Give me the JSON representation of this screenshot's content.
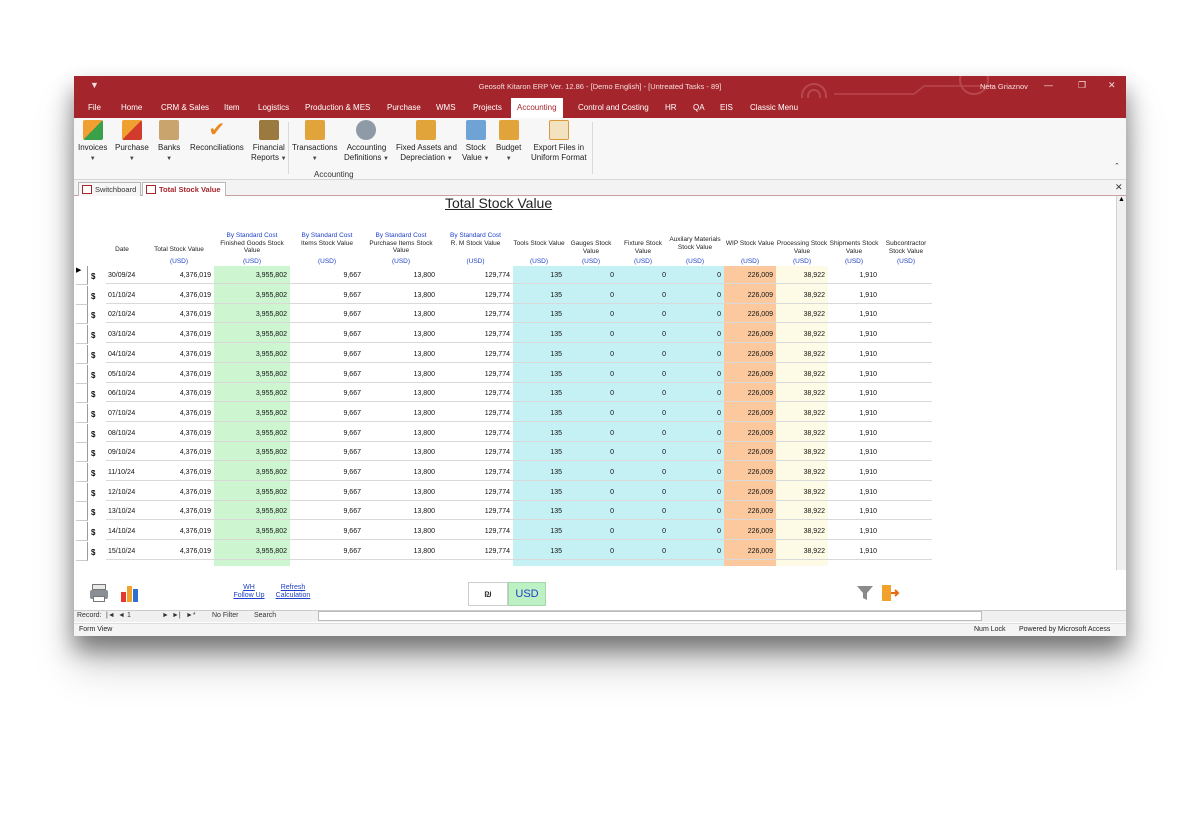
{
  "window": {
    "title": "Geosoft Kitaron ERP Ver. 12.86 - [Demo English] - [Untreated Tasks - 89]",
    "user": "Neta Griaznov"
  },
  "menu": [
    "File",
    "Home",
    "CRM & Sales",
    "Item",
    "Logistics",
    "Production & MES",
    "Purchase",
    "WMS",
    "Projects",
    "Accounting",
    "Control and Costing",
    "HR",
    "QA",
    "EIS",
    "Classic Menu"
  ],
  "menu_active": "Accounting",
  "ribbon": {
    "invoices": "Invoices",
    "purchase": "Purchase",
    "banks": "Banks",
    "reconciliations": "Reconciliations",
    "financial_1": "Financial",
    "financial_2": "Reports",
    "transactions": "Transactions",
    "accdef_1": "Accounting",
    "accdef_2": "Definitions",
    "fixed_1": "Fixed Assets and",
    "fixed_2": "Depreciation",
    "stock_1": "Stock",
    "stock_2": "Value",
    "budget": "Budget",
    "export_1": "Export Files in",
    "export_2": "Uniform Format",
    "group_label": "Accounting"
  },
  "tabs": {
    "switchboard": "Switchboard",
    "total_stock": "Total Stock Value"
  },
  "form_title": "Total Stock Value",
  "headers": {
    "date": "Date",
    "total": "Total Stock Value",
    "std": "By Standard Cost",
    "fg": "Finished Goods Stock Value",
    "items": "Items Stock Value",
    "purch": "Purchase Items Stock Value",
    "rm": "R. M Stock Value",
    "tools": "Tools Stock Value",
    "gauges": "Gauges Stock Value",
    "fixture": "Fixture Stock Value",
    "aux": "Auxilary Materials Stock Value",
    "wip": "WIP Stock Value",
    "processing": "Processing Stock Value",
    "shipments": "Shipments Stock Value",
    "subcon": "Subcontractor Stock Value",
    "usd": "(USD)"
  },
  "rows": [
    {
      "date": "30/09/24",
      "total": "4,376,019",
      "fg": "3,955,802",
      "items": "9,667",
      "purch": "13,800",
      "rm": "129,774",
      "tools": "135",
      "gauges": "0",
      "fixture": "0",
      "aux": "0",
      "wip": "226,009",
      "processing": "38,922",
      "shipments": "1,910",
      "subcon": ""
    },
    {
      "date": "01/10/24",
      "total": "4,376,019",
      "fg": "3,955,802",
      "items": "9,667",
      "purch": "13,800",
      "rm": "129,774",
      "tools": "135",
      "gauges": "0",
      "fixture": "0",
      "aux": "0",
      "wip": "226,009",
      "processing": "38,922",
      "shipments": "1,910",
      "subcon": ""
    },
    {
      "date": "02/10/24",
      "total": "4,376,019",
      "fg": "3,955,802",
      "items": "9,667",
      "purch": "13,800",
      "rm": "129,774",
      "tools": "135",
      "gauges": "0",
      "fixture": "0",
      "aux": "0",
      "wip": "226,009",
      "processing": "38,922",
      "shipments": "1,910",
      "subcon": ""
    },
    {
      "date": "03/10/24",
      "total": "4,376,019",
      "fg": "3,955,802",
      "items": "9,667",
      "purch": "13,800",
      "rm": "129,774",
      "tools": "135",
      "gauges": "0",
      "fixture": "0",
      "aux": "0",
      "wip": "226,009",
      "processing": "38,922",
      "shipments": "1,910",
      "subcon": ""
    },
    {
      "date": "04/10/24",
      "total": "4,376,019",
      "fg": "3,955,802",
      "items": "9,667",
      "purch": "13,800",
      "rm": "129,774",
      "tools": "135",
      "gauges": "0",
      "fixture": "0",
      "aux": "0",
      "wip": "226,009",
      "processing": "38,922",
      "shipments": "1,910",
      "subcon": ""
    },
    {
      "date": "05/10/24",
      "total": "4,376,019",
      "fg": "3,955,802",
      "items": "9,667",
      "purch": "13,800",
      "rm": "129,774",
      "tools": "135",
      "gauges": "0",
      "fixture": "0",
      "aux": "0",
      "wip": "226,009",
      "processing": "38,922",
      "shipments": "1,910",
      "subcon": ""
    },
    {
      "date": "06/10/24",
      "total": "4,376,019",
      "fg": "3,955,802",
      "items": "9,667",
      "purch": "13,800",
      "rm": "129,774",
      "tools": "135",
      "gauges": "0",
      "fixture": "0",
      "aux": "0",
      "wip": "226,009",
      "processing": "38,922",
      "shipments": "1,910",
      "subcon": ""
    },
    {
      "date": "07/10/24",
      "total": "4,376,019",
      "fg": "3,955,802",
      "items": "9,667",
      "purch": "13,800",
      "rm": "129,774",
      "tools": "135",
      "gauges": "0",
      "fixture": "0",
      "aux": "0",
      "wip": "226,009",
      "processing": "38,922",
      "shipments": "1,910",
      "subcon": ""
    },
    {
      "date": "08/10/24",
      "total": "4,376,019",
      "fg": "3,955,802",
      "items": "9,667",
      "purch": "13,800",
      "rm": "129,774",
      "tools": "135",
      "gauges": "0",
      "fixture": "0",
      "aux": "0",
      "wip": "226,009",
      "processing": "38,922",
      "shipments": "1,910",
      "subcon": ""
    },
    {
      "date": "09/10/24",
      "total": "4,376,019",
      "fg": "3,955,802",
      "items": "9,667",
      "purch": "13,800",
      "rm": "129,774",
      "tools": "135",
      "gauges": "0",
      "fixture": "0",
      "aux": "0",
      "wip": "226,009",
      "processing": "38,922",
      "shipments": "1,910",
      "subcon": ""
    },
    {
      "date": "11/10/24",
      "total": "4,376,019",
      "fg": "3,955,802",
      "items": "9,667",
      "purch": "13,800",
      "rm": "129,774",
      "tools": "135",
      "gauges": "0",
      "fixture": "0",
      "aux": "0",
      "wip": "226,009",
      "processing": "38,922",
      "shipments": "1,910",
      "subcon": ""
    },
    {
      "date": "12/10/24",
      "total": "4,376,019",
      "fg": "3,955,802",
      "items": "9,667",
      "purch": "13,800",
      "rm": "129,774",
      "tools": "135",
      "gauges": "0",
      "fixture": "0",
      "aux": "0",
      "wip": "226,009",
      "processing": "38,922",
      "shipments": "1,910",
      "subcon": ""
    },
    {
      "date": "13/10/24",
      "total": "4,376,019",
      "fg": "3,955,802",
      "items": "9,667",
      "purch": "13,800",
      "rm": "129,774",
      "tools": "135",
      "gauges": "0",
      "fixture": "0",
      "aux": "0",
      "wip": "226,009",
      "processing": "38,922",
      "shipments": "1,910",
      "subcon": ""
    },
    {
      "date": "14/10/24",
      "total": "4,376,019",
      "fg": "3,955,802",
      "items": "9,667",
      "purch": "13,800",
      "rm": "129,774",
      "tools": "135",
      "gauges": "0",
      "fixture": "0",
      "aux": "0",
      "wip": "226,009",
      "processing": "38,922",
      "shipments": "1,910",
      "subcon": ""
    },
    {
      "date": "15/10/24",
      "total": "4,376,019",
      "fg": "3,955,802",
      "items": "9,667",
      "purch": "13,800",
      "rm": "129,774",
      "tools": "135",
      "gauges": "0",
      "fixture": "0",
      "aux": "0",
      "wip": "226,009",
      "processing": "38,922",
      "shipments": "1,910",
      "subcon": ""
    }
  ],
  "column_colors": {
    "fg": "#ccf5d0",
    "tools": "#c6f1f4",
    "gauges": "#c6f1f4",
    "fixture": "#c6f1f4",
    "aux": "#c6f1f4",
    "wip": "#fcc99e",
    "processing": "#fdfbe6"
  },
  "footer": {
    "wh_1": "WH",
    "wh_2": "Follow Up",
    "refresh_1": "Refresh",
    "refresh_2": "Calculation",
    "currency_symbol": "₪",
    "currency": "USD"
  },
  "navbar": {
    "record": "Record:",
    "first": "|◄",
    "prev": "◄",
    "position": "1",
    "next": "►",
    "last": "►|",
    "new": "►*",
    "filter": "No Filter",
    "search": "Search"
  },
  "status": {
    "left": "Form View",
    "numlock": "Num Lock",
    "powered": "Powered by Microsoft Access"
  },
  "icons": {
    "qa": "quick-access-icon",
    "print": "printer-icon",
    "chart": "bar-chart-icon",
    "filter": "filter-icon",
    "exit": "exit-door-icon"
  }
}
